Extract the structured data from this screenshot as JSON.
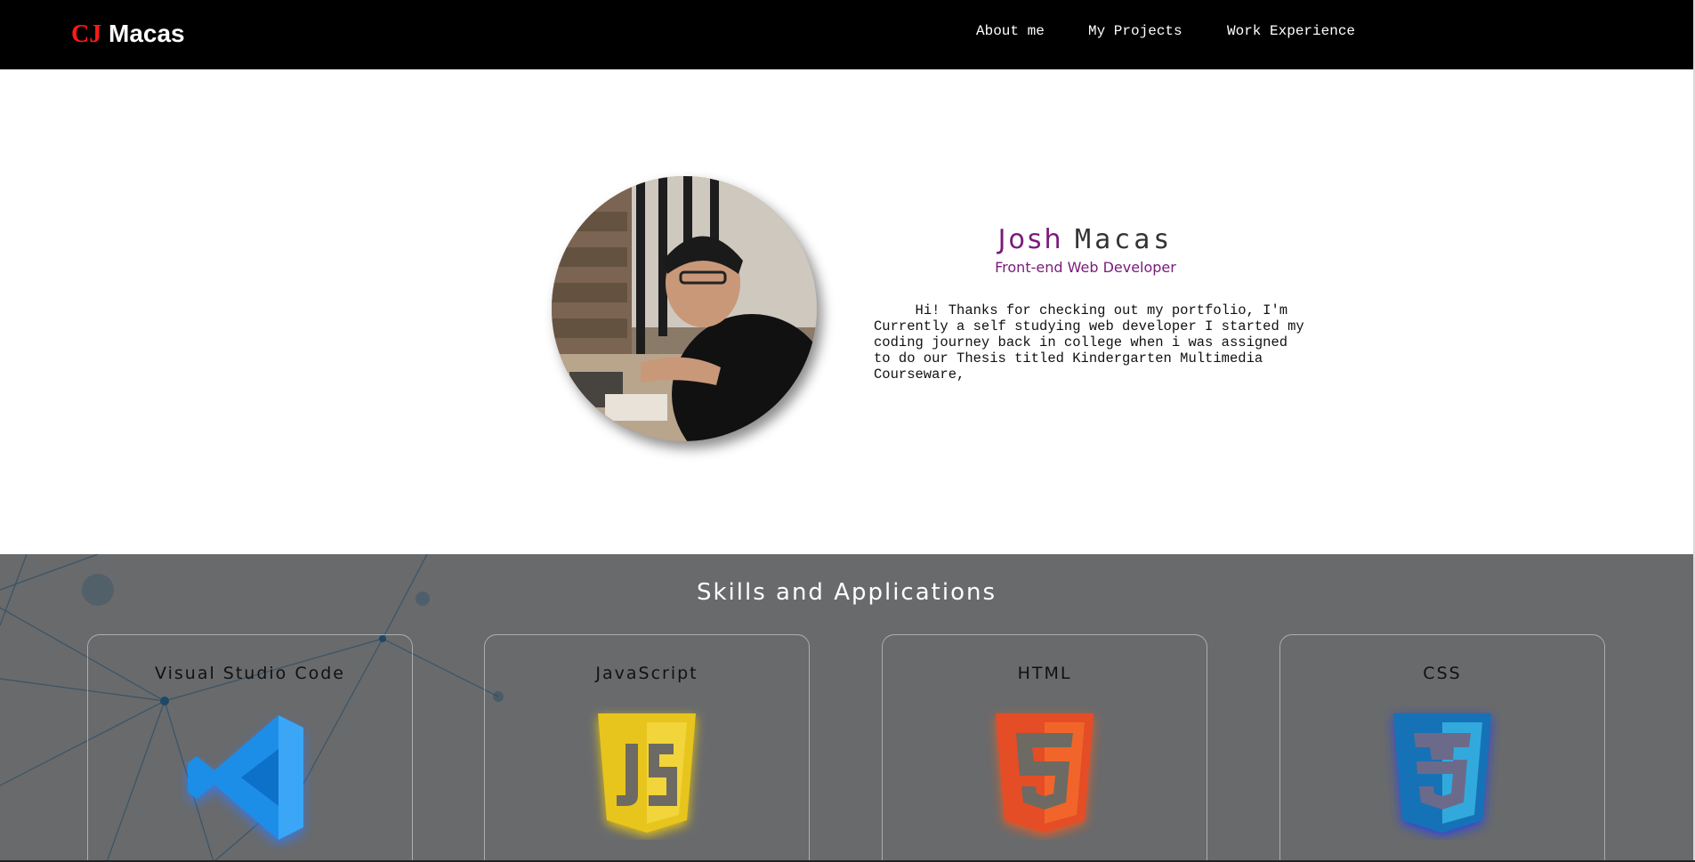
{
  "header": {
    "logo_first": "CJ",
    "logo_last": "Macas",
    "nav": [
      "About me",
      "My Projects",
      "Work Experience"
    ]
  },
  "hero": {
    "first_name": "Josh",
    "last_name": "Macas",
    "role": "Front-end Web Developer",
    "bio": "     Hi! Thanks for checking out my portfolio, I'm\nCurrently a self studying web developer I started my\ncoding journey back in college when i was assigned\nto do our Thesis titled Kindergarten Multimedia\nCourseware,"
  },
  "skills": {
    "title": "Skills and Applications",
    "cards": [
      {
        "label": "Visual Studio Code",
        "icon": "vscode-icon"
      },
      {
        "label": "JavaScript",
        "icon": "javascript-icon"
      },
      {
        "label": "HTML",
        "icon": "html5-icon"
      },
      {
        "label": "CSS",
        "icon": "css3-icon"
      }
    ]
  },
  "colors": {
    "header_bg": "#000000",
    "logo_accent": "#ff1a1a",
    "name_accent": "#7a1a7a",
    "skills_bg": "#696a6c"
  }
}
